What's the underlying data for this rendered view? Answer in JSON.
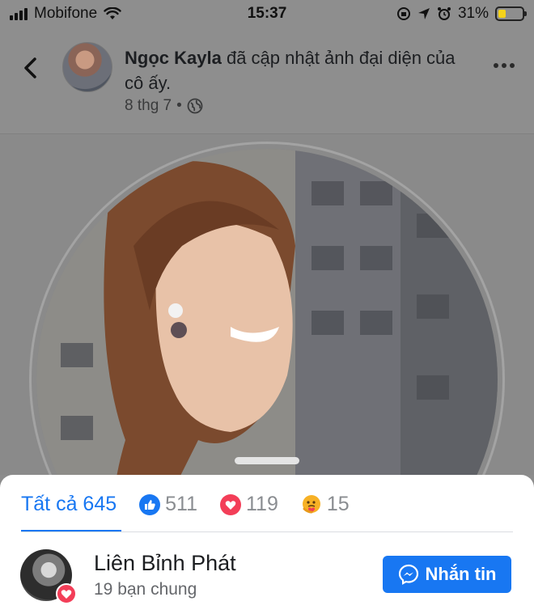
{
  "status_bar": {
    "carrier": "Mobifone",
    "time": "15:37",
    "battery": "31%",
    "battery_level": 0.31,
    "icons": [
      "signal-icon",
      "wifi-icon",
      "rotation-lock-icon",
      "location-icon",
      "alarm-icon",
      "battery-icon"
    ]
  },
  "header": {
    "author": "Ngọc Kayla",
    "action_text": "đã cập nhật ảnh đại diện của cô ấy.",
    "date": "8 thg 7",
    "separator": "•",
    "icons": [
      "back-icon",
      "globe-icon",
      "more-icon"
    ]
  },
  "reactions_sheet": {
    "tabs": [
      {
        "label": "Tất cả 645",
        "active": true
      },
      {
        "count": "511",
        "icon": "like-icon",
        "color": "#1877f2"
      },
      {
        "count": "119",
        "icon": "love-icon",
        "color": "#f33e58"
      },
      {
        "count": "15",
        "icon": "care-icon",
        "color": "#f7b125"
      }
    ]
  },
  "person": {
    "name": "Liên Bỉnh Phát",
    "mutual": "19 bạn chung",
    "reaction": "love-icon",
    "button_label": "Nhắn tin",
    "button_icon": "messenger-icon"
  },
  "colors": {
    "accent": "#1877f2",
    "love": "#f33e58",
    "care": "#f7b125",
    "overlay": "#8e8e8e"
  }
}
